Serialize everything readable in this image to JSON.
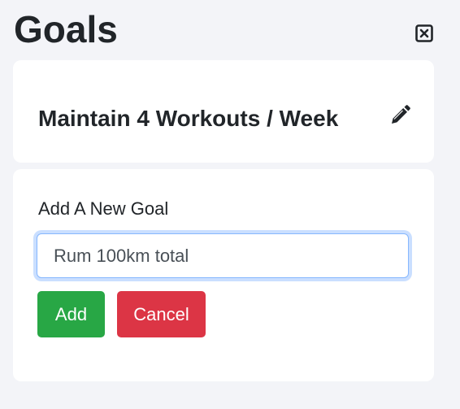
{
  "page": {
    "title": "Goals"
  },
  "goal_card": {
    "goal_text": "Maintain 4 Workouts / Week"
  },
  "new_goal_form": {
    "label": "Add A New Goal",
    "input_value": "Rum 100km total",
    "add_label": "Add",
    "cancel_label": "Cancel"
  },
  "icons": {
    "close": "close-square-icon",
    "edit": "pencil-icon"
  },
  "colors": {
    "background": "#f3f4f8",
    "add_button": "#28a745",
    "cancel_button": "#dc3545",
    "input_focus": "#86b7fe"
  }
}
